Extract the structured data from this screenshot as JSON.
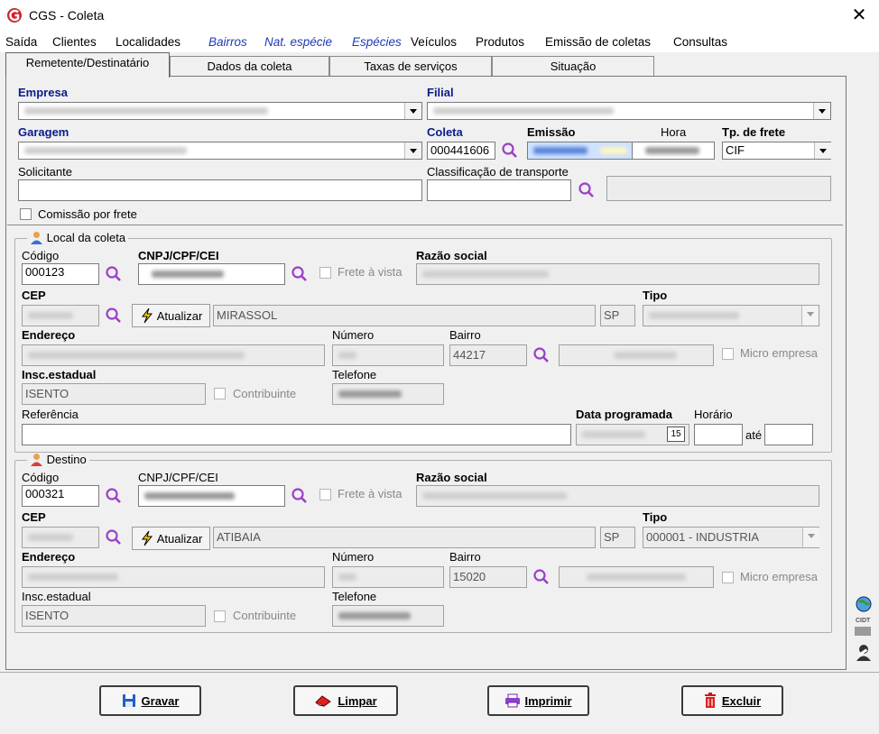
{
  "window": {
    "title": "CGS - Coleta"
  },
  "menu": [
    "Saída",
    "Clientes",
    "Localidades",
    "Bairros",
    "Nat. espécie",
    "Espécies",
    "Veículos",
    "Produtos",
    "Emissão de coletas",
    "Consultas"
  ],
  "tabs": [
    "Remetente/Destinatário",
    "Dados da coleta",
    "Taxas de serviços",
    "Situação"
  ],
  "header": {
    "empresa_label": "Empresa",
    "filial_label": "Filial",
    "garagem_label": "Garagem",
    "coleta_label": "Coleta",
    "coleta_value": "000441606",
    "emissao_label": "Emissão",
    "hora_label": "Hora",
    "tp_frete_label": "Tp. de frete",
    "tp_frete_value": "CIF",
    "solicitante_label": "Solicitante",
    "classificacao_label": "Classificação de transporte",
    "comissao_label": "Comissão por frete"
  },
  "local": {
    "group_title": "Local da coleta",
    "codigo_label": "Código",
    "codigo_value": "000123",
    "cnpj_label": "CNPJ/CPF/CEI",
    "frete_vista_label": "Frete à vista",
    "razao_label": "Razão social",
    "cep_label": "CEP",
    "atualizar_label": "Atualizar",
    "cidade_value": "MIRASSOL",
    "uf_value": "SP",
    "tipo_label": "Tipo",
    "endereco_label": "Endereço",
    "numero_label": "Número",
    "bairro_label": "Bairro",
    "bairro_value": "44217",
    "micro_label": "Micro empresa",
    "insc_label": "Insc.estadual",
    "insc_value": "ISENTO",
    "contribuinte_label": "Contribuinte",
    "telefone_label": "Telefone",
    "referencia_label": "Referência",
    "data_prog_label": "Data programada",
    "horario_label": "Horário",
    "ate_label": "até",
    "cal_label": "15"
  },
  "destino": {
    "group_title": "Destino",
    "codigo_label": "Código",
    "codigo_value": "000321",
    "cnpj_label": "CNPJ/CPF/CEI",
    "frete_vista_label": "Frete à vista",
    "razao_label": "Razão social",
    "cep_label": "CEP",
    "atualizar_label": "Atualizar",
    "cidade_value": "ATIBAIA",
    "uf_value": "SP",
    "tipo_label": "Tipo",
    "tipo_value": "000001 - INDUSTRIA",
    "endereco_label": "Endereço",
    "numero_label": "Número",
    "bairro_label": "Bairro",
    "bairro_value": "15020",
    "micro_label": "Micro empresa",
    "insc_label": "Insc.estadual",
    "insc_value": "ISENTO",
    "contribuinte_label": "Contribuinte",
    "telefone_label": "Telefone"
  },
  "buttons": {
    "gravar": "Gravar",
    "limpar": "Limpar",
    "imprimir": "Imprimir",
    "excluir": "Excluir"
  },
  "side": {
    "cidt_label": "CIDT"
  },
  "colors": {
    "blue_label": "#0a1c8c",
    "menu_blue": "#1f3bb3",
    "brand_red": "#d0202a",
    "search_purple": "#9b3fc9"
  }
}
